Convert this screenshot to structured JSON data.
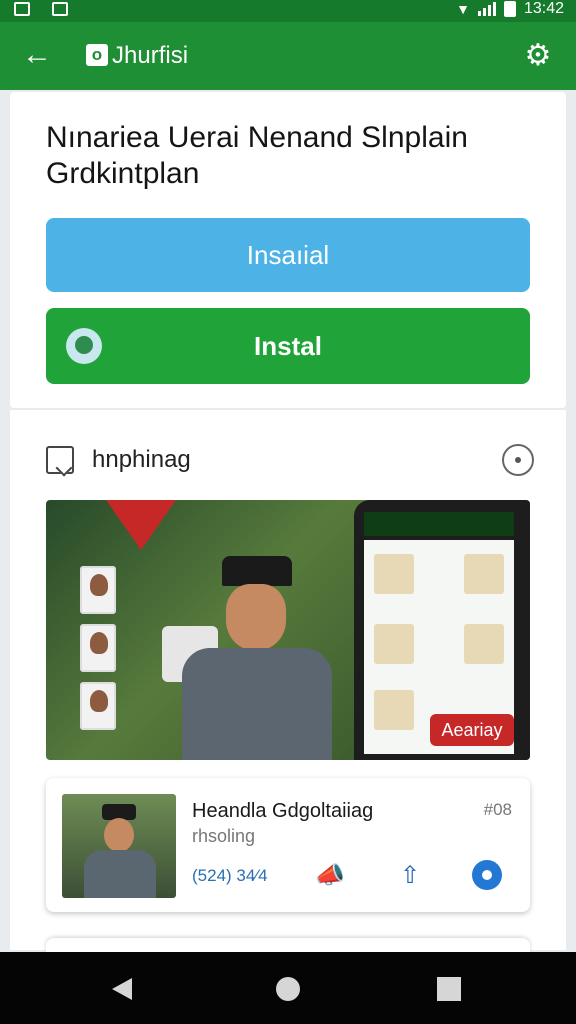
{
  "status_bar": {
    "time": "13:42",
    "wifi_icon": "wifi-icon",
    "signal_icon": "signal-icon",
    "battery_icon": "battery-icon"
  },
  "app_bar": {
    "title": "Jhurfisi",
    "logo_text": "o",
    "back_icon": "arrow-left-icon",
    "settings_icon": "gear-icon"
  },
  "main_card": {
    "headline": "Nınariea Uerai Nenand Slnplain Grdkintplan",
    "primary_button": "Insaıial",
    "install_button": "Instal"
  },
  "section": {
    "label": "hnphinag",
    "icon": "document-icon",
    "more_icon": "circle-dot-icon"
  },
  "hero": {
    "tag_label": "Aeariay"
  },
  "list_item": {
    "title": "Heandla Gdgoltaiiag",
    "subtitle": "rhsoling",
    "badge": "#08",
    "count": "(524) 34⁄4",
    "like_icon": "megaphone-icon",
    "share_icon": "share-upload-icon",
    "view_icon": "eye-icon"
  },
  "nav_bar": {
    "back_icon": "back-triangle-icon",
    "home_icon": "home-circle-icon",
    "recents_icon": "recents-square-icon"
  },
  "colors": {
    "app_bar": "#1e8f34",
    "status_bar": "#167a2c",
    "primary_button": "#4db3e6",
    "install_button": "#20a43a",
    "hero_tag": "#c62828",
    "accent_blue": "#2378d6"
  }
}
